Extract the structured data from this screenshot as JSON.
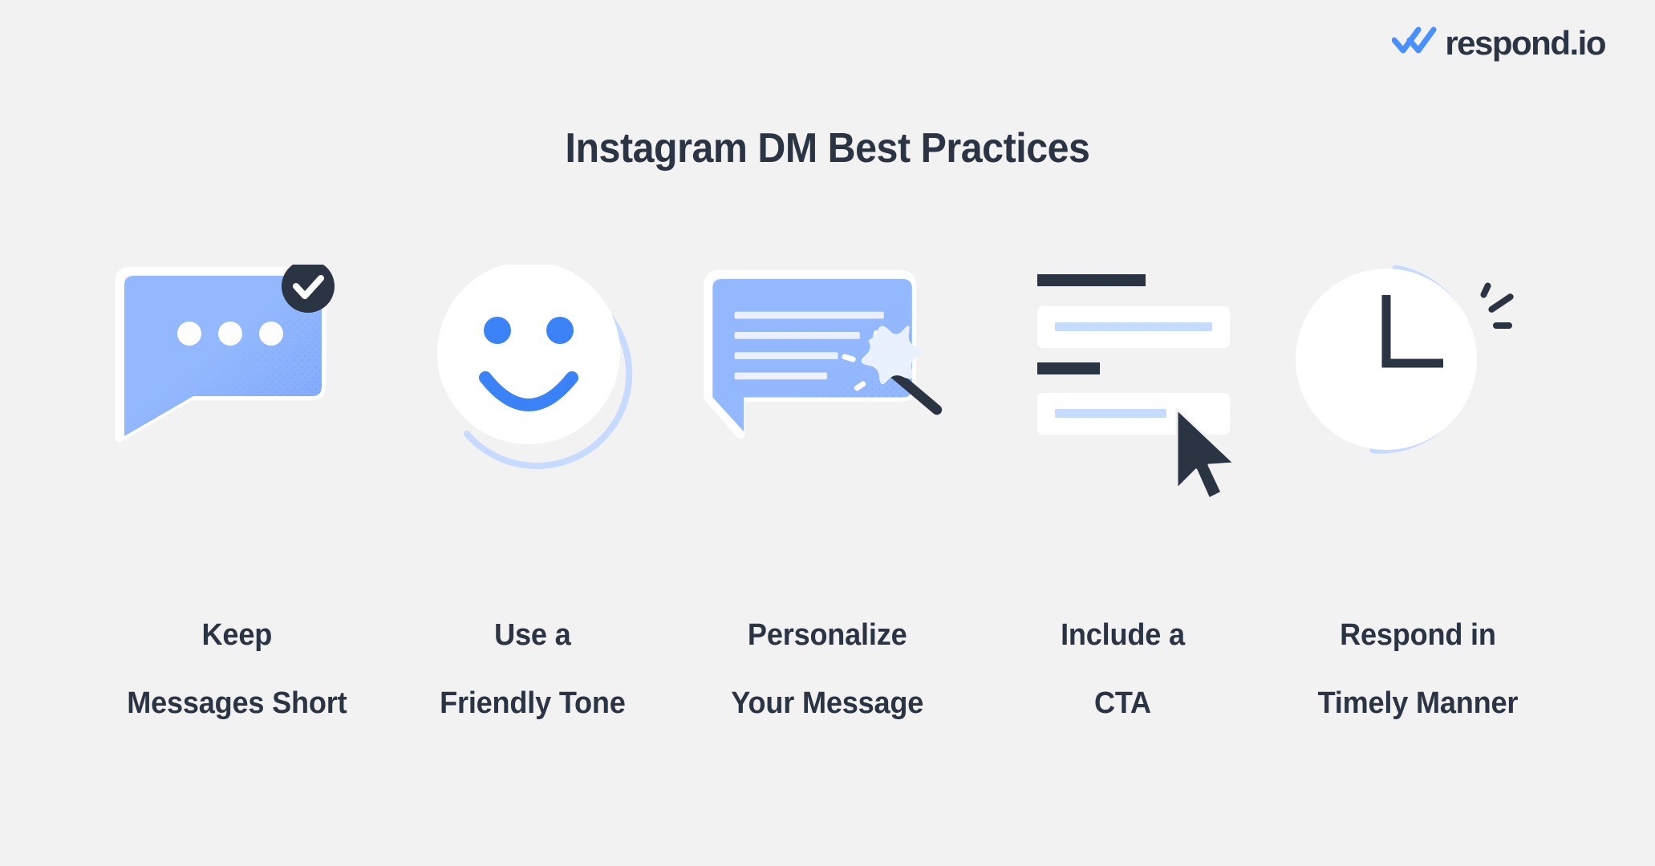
{
  "brand": {
    "logo_text": "respond.io",
    "logo_icon": "double-check-icon",
    "accent_blue": "#3b82f6",
    "soft_blue": "#93b8fd",
    "pale_blue": "#c7daff",
    "navy": "#2b3442",
    "background": "#f2f2f2"
  },
  "header": {
    "title": "Instagram DM Best Practices"
  },
  "practices": [
    {
      "index": "1",
      "icon": "speech-bubble-typing-check-icon",
      "label_line1": "Keep",
      "label_line2": "Messages Short"
    },
    {
      "index": "2",
      "icon": "smiley-face-icon",
      "label_line1": "Use a",
      "label_line2": "Friendly Tone"
    },
    {
      "index": "3",
      "icon": "speech-bubble-magic-wand-icon",
      "label_line1": "Personalize",
      "label_line2": "Your Message"
    },
    {
      "index": "4",
      "icon": "form-fields-cursor-icon",
      "label_line1": "Include a",
      "label_line2": "CTA"
    },
    {
      "index": "5",
      "icon": "clock-icon",
      "label_line1": "Respond in",
      "label_line2": "Timely Manner"
    }
  ]
}
